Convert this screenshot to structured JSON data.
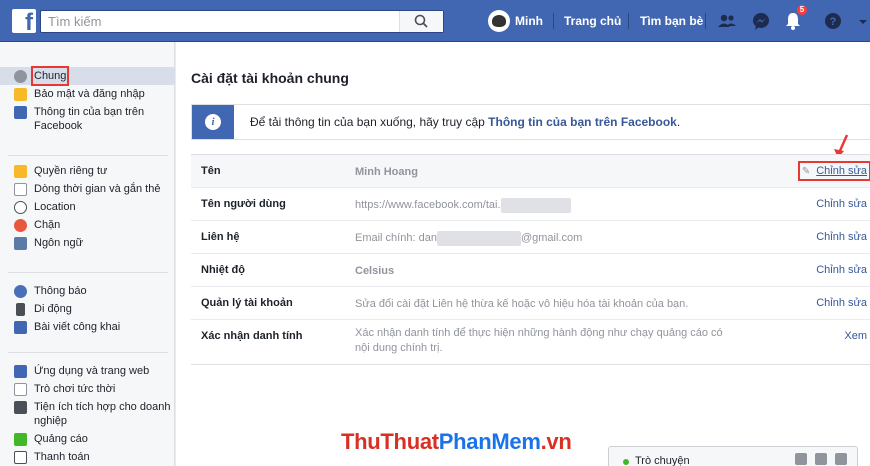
{
  "colors": {
    "brand": "#4267b2",
    "link": "#365899",
    "highlight": "#e53935"
  },
  "topbar": {
    "logo_letter": "f",
    "search_placeholder": "Tìm kiếm",
    "user_name": "Minh",
    "home_label": "Trang chủ",
    "friends_label": "Tìm bạn bè",
    "notification_count": "5",
    "icons": [
      "search-icon",
      "friend-requests-icon",
      "messenger-icon",
      "notifications-icon",
      "help-icon",
      "chevron-down-icon"
    ]
  },
  "sidebar": {
    "items": [
      {
        "label": "Chung",
        "icon": "gear-icon",
        "color": "#90949c"
      },
      {
        "label": "Bảo mật và đăng nhập",
        "icon": "shield-icon",
        "color": "#f7b928"
      },
      {
        "label": "Thông tin của bạn trên Facebook",
        "icon": "facebook-icon",
        "color": "#4267b2"
      },
      {
        "label": "Quyền riêng tư",
        "icon": "lock-icon",
        "color": "#f7b928"
      },
      {
        "label": "Dòng thời gian và gắn thẻ",
        "icon": "timeline-icon",
        "color": "#90949c"
      },
      {
        "label": "Location",
        "icon": "location-icon",
        "color": "#4b4f56"
      },
      {
        "label": "Chặn",
        "icon": "block-icon",
        "color": "#e9573f"
      },
      {
        "label": "Ngôn ngữ",
        "icon": "language-icon",
        "color": "#5b7aa8"
      },
      {
        "label": "Thông báo",
        "icon": "globe-icon",
        "color": "#4b6eb8"
      },
      {
        "label": "Di động",
        "icon": "mobile-icon",
        "color": "#4b4f56"
      },
      {
        "label": "Bài viết công khai",
        "icon": "rss-icon",
        "color": "#4267b2"
      },
      {
        "label": "Ứng dụng và trang web",
        "icon": "apps-icon",
        "color": "#4267b2"
      },
      {
        "label": "Trò chơi tức thời",
        "icon": "game-icon",
        "color": "#90949c"
      },
      {
        "label": "Tiện ích tích hợp cho doanh nghiệp",
        "icon": "business-icon",
        "color": "#4b4f56"
      },
      {
        "label": "Quảng cáo",
        "icon": "ads-icon",
        "color": "#42b72a"
      },
      {
        "label": "Thanh toán",
        "icon": "payment-icon",
        "color": "#4b4f56"
      }
    ]
  },
  "main": {
    "title": "Cài đặt tài khoản chung",
    "info": {
      "text": "Để tải thông tin của bạn xuống, hãy truy cập ",
      "link": "Thông tin của bạn trên Facebook",
      "suffix": "."
    },
    "rows": [
      {
        "label": "Tên",
        "value": "Minh Hoang",
        "action": "Chỉnh sửa"
      },
      {
        "label": "Tên người dùng",
        "value": "https://www.facebook.com/tai.",
        "action": "Chỉnh sửa"
      },
      {
        "label": "Liên hệ",
        "value_prefix": "Email chính: dan",
        "value_suffix": "@gmail.com",
        "action": "Chỉnh sửa"
      },
      {
        "label": "Nhiệt độ",
        "value": "Celsius",
        "action": "Chỉnh sửa"
      },
      {
        "label": "Quản lý tài khoản",
        "value": "Sửa đổi cài đặt Liên hệ thừa kế hoặc vô hiệu hóa tài khoản của bạn.",
        "action": "Chỉnh sửa"
      },
      {
        "label": "Xác nhận danh tính",
        "value": "Xác nhận danh tính để thực hiện những hành động như chạy quảng cáo có nội dung chính trị.",
        "action": "Xem"
      }
    ]
  },
  "watermark": {
    "part1": "ThuThuat",
    "part2": "PhanMem",
    "part3": ".vn"
  },
  "chat": {
    "label": "Trò chuyện"
  }
}
